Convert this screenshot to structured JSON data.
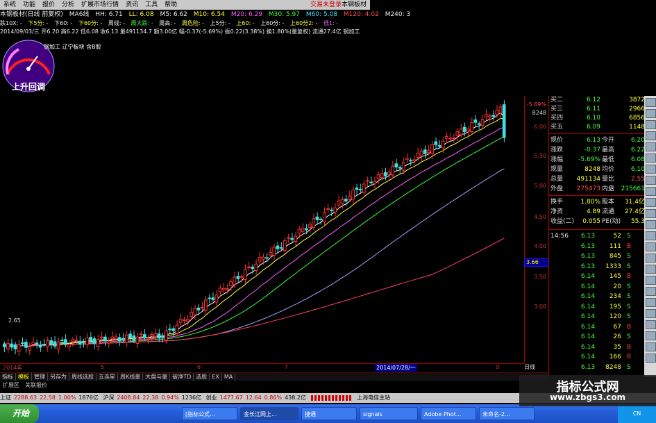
{
  "menu": {
    "items": [
      "系统",
      "功能",
      "报价",
      "分析",
      "扩展市场行情",
      "资讯",
      "工具",
      "帮助"
    ],
    "login": "交易未登录",
    "stock": "本钢板材"
  },
  "title": {
    "name": "本钢板材(日线 前复权)",
    "ma_label": "MA6线",
    "hh": "HH: 6.71",
    "ll": "LL: 6.08",
    "m5": "M5: 6.62",
    "m10": "M10: 6.54",
    "m20": "M20: 6.29",
    "m30": "M30: 5.97",
    "m60": "M60: 5.08",
    "m120": "M120: 4.02",
    "m240": "M240: 3"
  },
  "info1": {
    "a": "跌10X: -",
    "b": "下5分: -",
    "c": "下60: -",
    "d": "下60分: -",
    "e": "周线: -",
    "f": "周大跌: -",
    "g": "周高: -",
    "h": "周危险: -",
    "i": "上5分: -",
    "j": "上60: -",
    "k": "上60分: -",
    "l": "上60分2: -",
    "m": "低1: -"
  },
  "info2": "2014/09/03/三 开6.20 高6.22 低6.08 收6.13 量491134.7 额3.00亿 幅-0.37(-5.69%) 振0.22(3.38%) 换1.80%(量复权) 流通27.4亿 钢加工",
  "board": "钢加工 辽宁板块 含B股",
  "gauge_text": "上升回调",
  "chart_data": {
    "type": "candlestick",
    "title": "本钢板材(日线 前复权)",
    "yticks": [
      3.0,
      3.5,
      4.0,
      4.5,
      5.0,
      5.5,
      6.0
    ],
    "ylim": [
      2.4,
      6.8
    ],
    "xticks": [
      "2014年",
      "5",
      "6",
      "7",
      "2014/07/28/一",
      "9"
    ],
    "annotations": [
      "2.65",
      "-5.69%",
      "8248",
      "3.66"
    ],
    "last_close": 6.13,
    "ma": {
      "M5": 6.62,
      "M10": 6.54,
      "M20": 6.29,
      "M30": 5.97,
      "M60": 5.08,
      "M120": 4.02
    }
  },
  "yaxis_labels": [
    "6.00",
    "5.50",
    "5.00",
    "4.50",
    "4.00",
    "3.50",
    "3.00"
  ],
  "yaxis_top": [
    "-5.69%",
    "8248"
  ],
  "y_highlight": "3.66",
  "xaxis_labels": [
    "2014年",
    "5",
    "6",
    "7",
    "2014/07/28/一",
    "9"
  ],
  "quote": {
    "bids": [
      {
        "l": "买二",
        "v": "6.12",
        "q": "3872"
      },
      {
        "l": "买三",
        "v": "6.11",
        "q": "2966"
      },
      {
        "l": "买四",
        "v": "6.10",
        "q": "6856"
      },
      {
        "l": "买五",
        "v": "6.09",
        "q": "1148"
      }
    ],
    "rows": [
      {
        "l": "现价",
        "v": "6.13",
        "l2": "今开",
        "v2": "6.20"
      },
      {
        "l": "涨跌",
        "v": "-0.37",
        "l2": "最高",
        "v2": "6.22"
      },
      {
        "l": "涨幅",
        "v": "-5.69%",
        "l2": "最低",
        "v2": "6.08"
      },
      {
        "l": "现量",
        "v": "8248",
        "l2": "均价",
        "v2": "6.10"
      },
      {
        "l": "总量",
        "v": "491134",
        "l2": "量比",
        "v2": "2.55"
      },
      {
        "l": "外盘",
        "v": "275473",
        "l2": "内盘",
        "v2": "215661"
      },
      {
        "l": "换手",
        "v": "1.80%",
        "l2": "股本",
        "v2": "31.4亿"
      },
      {
        "l": "净资",
        "v": "4.89",
        "l2": "流通",
        "v2": "27.4亿"
      },
      {
        "l": "收益(二)",
        "v": "0.055",
        "l2": "PE(动)",
        "v2": "55.3"
      }
    ],
    "ticks": [
      {
        "t": "14:56",
        "p": "6.13",
        "q": "52",
        "d": "S"
      },
      {
        "t": "",
        "p": "6.13",
        "q": "111",
        "d": "B"
      },
      {
        "t": "",
        "p": "6.13",
        "q": "845",
        "d": "S"
      },
      {
        "t": "",
        "p": "6.13",
        "q": "1333",
        "d": "S"
      },
      {
        "t": "",
        "p": "6.14",
        "q": "145",
        "d": "B"
      },
      {
        "t": "",
        "p": "6.14",
        "q": "20",
        "d": "S"
      },
      {
        "t": "",
        "p": "6.14",
        "q": "234",
        "d": "S"
      },
      {
        "t": "",
        "p": "6.14",
        "q": "195",
        "d": "S"
      },
      {
        "t": "",
        "p": "6.14",
        "q": "120",
        "d": "S"
      },
      {
        "t": "",
        "p": "6.14",
        "q": "67",
        "d": "B"
      },
      {
        "t": "",
        "p": "6.14",
        "q": "26",
        "d": "S"
      },
      {
        "t": "",
        "p": "6.14",
        "q": "35",
        "d": "B"
      },
      {
        "t": "",
        "p": "6.14",
        "q": "166",
        "d": "B"
      },
      {
        "t": "",
        "p": "6.13",
        "q": "8248",
        "d": "S"
      }
    ]
  },
  "tabs": {
    "right": "日线",
    "row1": [
      "指标",
      "模板",
      "管理",
      "另存为",
      "周线选股",
      "五连星",
      "周K线量",
      "大盘与量",
      "破净TD",
      "选股",
      "EX",
      "MA"
    ],
    "row1_active": "模板",
    "row2": [
      "扩展区",
      "关联报价"
    ]
  },
  "indexbar": {
    "sh_label": "上证",
    "sh_val": "2288.63",
    "sh_chg": "22.58",
    "sh_pct": "1.00%",
    "sh_amt": "1876亿",
    "sz_label": "沪深",
    "sz_val": "2408.84",
    "sz_chg": "22.38",
    "sz_pct": "0.94%",
    "sz_amt": "1236亿",
    "cy_label": "创业",
    "cy_val": "1477.67",
    "cy_chg": "12.64",
    "cy_pct": "0.86%",
    "cy_amt": "438.2亿",
    "server": "上海电信主站"
  },
  "taskbar": {
    "start": "开始",
    "tasks": [
      "[指标公式...",
      "金长江网上...",
      "捷通",
      "signals",
      "Adobe Phot...",
      "未命名-2..."
    ],
    "tray": "CN"
  },
  "watermark": {
    "line1": "指标公式网",
    "line2": "www.zbgs3.com"
  }
}
